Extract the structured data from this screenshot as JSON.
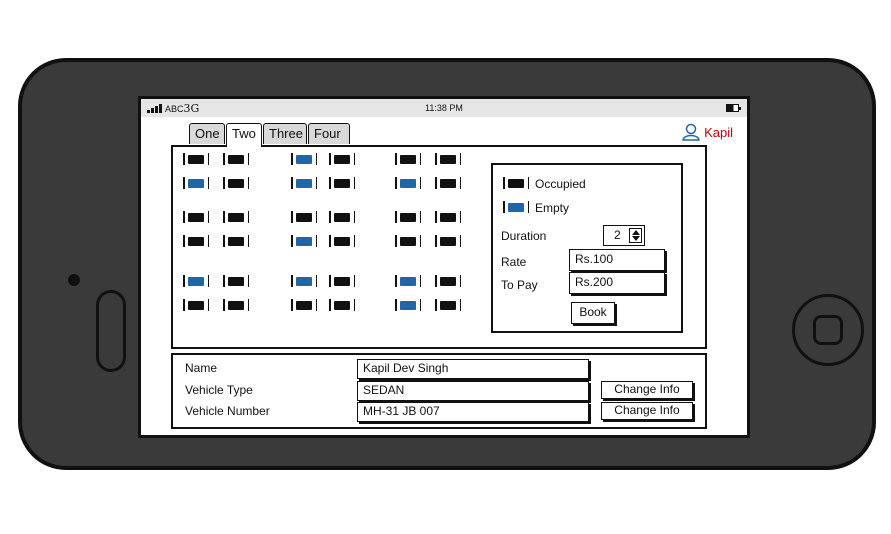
{
  "status_bar": {
    "carrier": "ABC",
    "network": "3G",
    "time": "11:38 PM"
  },
  "tabs": [
    {
      "label": "One",
      "active": false
    },
    {
      "label": "Two",
      "active": true
    },
    {
      "label": "Three",
      "active": false
    },
    {
      "label": "Four",
      "active": false
    }
  ],
  "user": {
    "name": "Kapil",
    "icon": "user-icon",
    "color": "#cc0000"
  },
  "seat_colors": {
    "occupied": "#111111",
    "empty": "#1f66a8"
  },
  "seat_rows": [
    [
      "occupied",
      "occupied",
      "empty",
      "occupied",
      "occupied",
      "occupied"
    ],
    [
      "empty",
      "occupied",
      "empty",
      "occupied",
      "empty",
      "occupied"
    ],
    [
      "occupied",
      "occupied",
      "occupied",
      "occupied",
      "occupied",
      "occupied"
    ],
    [
      "occupied",
      "occupied",
      "empty",
      "occupied",
      "occupied",
      "occupied"
    ],
    [
      "empty",
      "occupied",
      "empty",
      "occupied",
      "empty",
      "occupied"
    ],
    [
      "occupied",
      "occupied",
      "occupied",
      "occupied",
      "empty",
      "occupied"
    ]
  ],
  "legend": {
    "occupied_label": "Occupied",
    "empty_label": "Empty"
  },
  "booking": {
    "duration_label": "Duration",
    "duration_value": "2",
    "rate_label": "Rate",
    "rate_value": "Rs.100",
    "to_pay_label": "To Pay",
    "to_pay_value": "Rs.200",
    "book_button": "Book"
  },
  "vehicle_info": {
    "name_label": "Name",
    "name_value": "Kapil Dev Singh",
    "type_label": "Vehicle Type",
    "type_value": "SEDAN",
    "number_label": "Vehicle Number",
    "number_value": "MH-31 JB 007",
    "change_type_button": "Change Info",
    "change_number_button": "Change Info"
  }
}
